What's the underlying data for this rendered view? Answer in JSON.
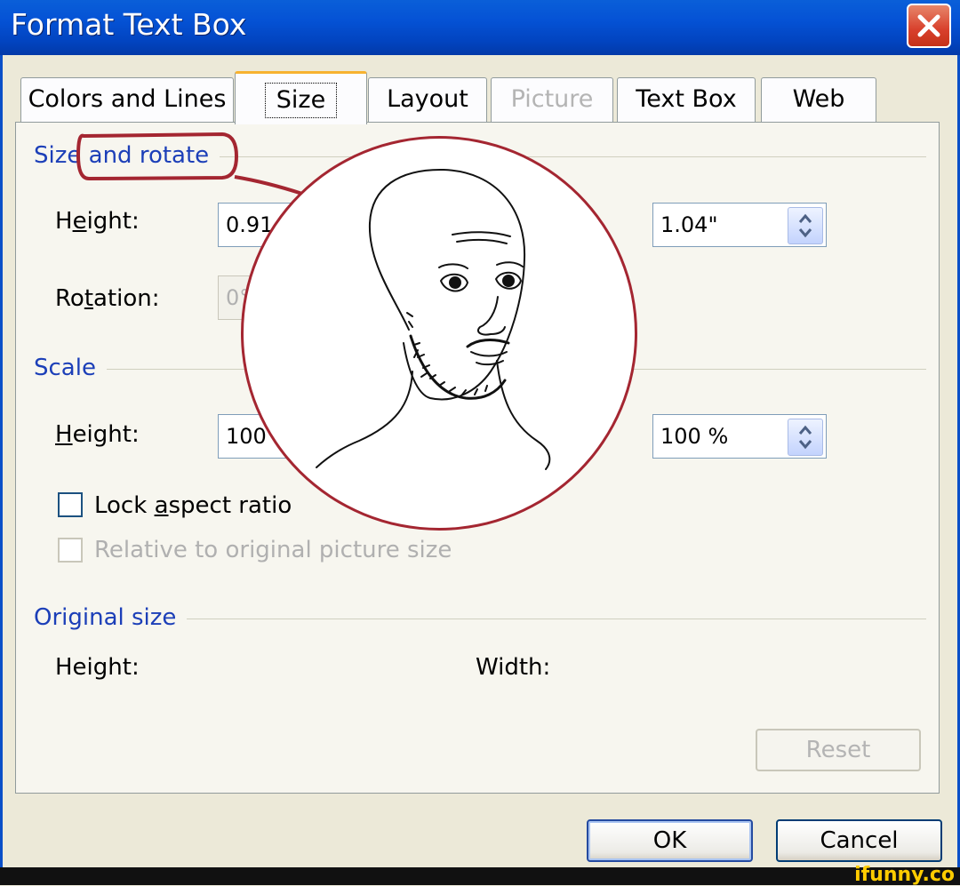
{
  "window": {
    "title": "Format Text Box"
  },
  "tabs": [
    {
      "label": "Colors and Lines",
      "state": "normal"
    },
    {
      "label": "Size",
      "state": "active"
    },
    {
      "label": "Layout",
      "state": "normal"
    },
    {
      "label": "Picture",
      "state": "disabled"
    },
    {
      "label": "Text Box",
      "state": "normal"
    },
    {
      "label": "Web",
      "state": "normal"
    }
  ],
  "size_rotate": {
    "label_prefix": "Size",
    "label_suffix": "and rotate",
    "height_label_pre": "H",
    "height_label_ul": "e",
    "height_label_post": "ight:",
    "height_value": "0.91",
    "width_value": "1.04\"",
    "rotation_label_pre": "Ro",
    "rotation_label_ul": "t",
    "rotation_label_post": "ation:",
    "rotation_value": "0°"
  },
  "scale": {
    "label": "Scale",
    "height_label_ul": "H",
    "height_label_post": "eight:",
    "height_value": "100",
    "width_value": "100 %",
    "lock_pre": "Lock ",
    "lock_ul": "a",
    "lock_post": "spect ratio",
    "lock_checked": false,
    "relative_label": "Relative to original picture size",
    "relative_checked": false
  },
  "original_size": {
    "label": "Original size",
    "height_label": "Height:",
    "width_label": "Width:"
  },
  "buttons": {
    "reset": "Reset",
    "ok": "OK",
    "cancel": "Cancel"
  },
  "watermark": "ifunny.co",
  "colors": {
    "titlebar": "#0553d6",
    "annotation": "#a42631",
    "group_label": "#1c3fb8"
  }
}
